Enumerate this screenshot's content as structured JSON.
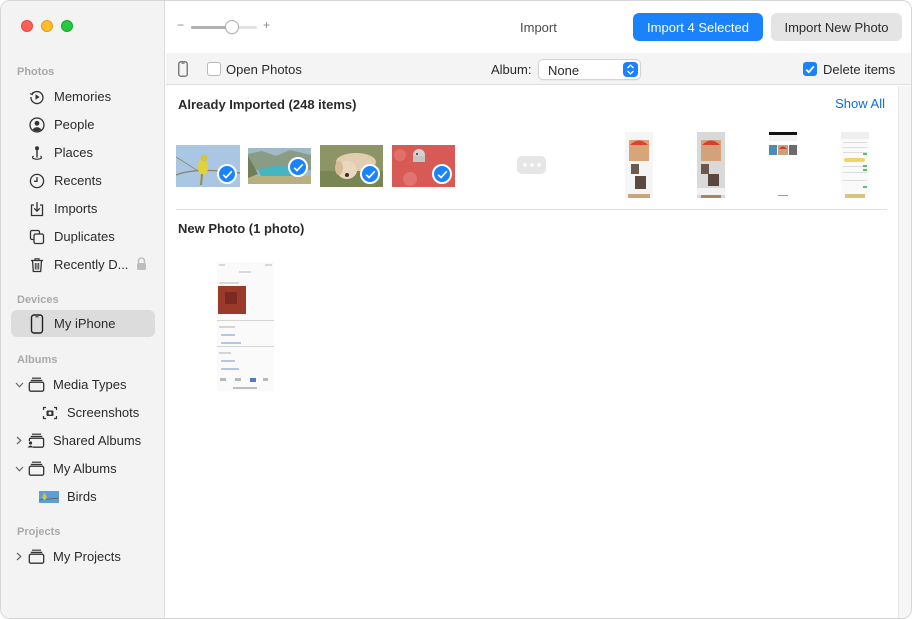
{
  "window": {
    "title": "Import"
  },
  "sidebar": {
    "sections": [
      {
        "label": "Photos",
        "items": [
          {
            "label": "Memories",
            "icon": "memories-icon"
          },
          {
            "label": "People",
            "icon": "people-icon"
          },
          {
            "label": "Places",
            "icon": "places-icon"
          },
          {
            "label": "Recents",
            "icon": "recents-icon"
          },
          {
            "label": "Imports",
            "icon": "imports-icon"
          },
          {
            "label": "Duplicates",
            "icon": "duplicates-icon"
          },
          {
            "label": "Recently D...",
            "icon": "trash-icon",
            "locked": true
          }
        ]
      },
      {
        "label": "Devices",
        "items": [
          {
            "label": "My iPhone",
            "icon": "iphone-icon",
            "selected": true
          }
        ]
      },
      {
        "label": "Albums",
        "items": [
          {
            "label": "Media Types",
            "icon": "album-stack-icon",
            "disclosure": "expanded"
          },
          {
            "label": "Screenshots",
            "icon": "screenshot-icon"
          },
          {
            "label": "Shared Albums",
            "icon": "shared-albums-icon",
            "disclosure": "collapsed"
          },
          {
            "label": "My Albums",
            "icon": "album-stack-icon",
            "disclosure": "expanded"
          },
          {
            "label": "Birds",
            "icon": "birds-album-thumbnail"
          }
        ]
      },
      {
        "label": "Projects",
        "items": [
          {
            "label": "My Projects",
            "icon": "album-stack-icon",
            "disclosure": "collapsed"
          }
        ]
      }
    ]
  },
  "toolbar": {
    "zoom_minus": "−",
    "zoom_plus": "+",
    "zoom_level": 0.62,
    "title": "Import",
    "import_selected_label": "Import 4 Selected",
    "import_new_label": "Import New Photo"
  },
  "options": {
    "open_photos_label": "Open Photos",
    "open_photos_checked": false,
    "album_label": "Album:",
    "album_value": "None",
    "delete_items_label": "Delete items",
    "delete_items_checked": true
  },
  "colors": {
    "accent": "#1a82fb",
    "link": "#0a6fe0"
  },
  "already_imported": {
    "title": "Already Imported (248 items)",
    "show_all_label": "Show All",
    "items": [
      {
        "subject": "yellow bird on branch",
        "selected": true
      },
      {
        "subject": "mountain lake",
        "selected": true
      },
      {
        "subject": "golden retriever puppy",
        "selected": true
      },
      {
        "subject": "dog in red flowers",
        "selected": true
      },
      {
        "subject": "more",
        "type": "ellipsis"
      },
      {
        "subject": "phone screenshot with cat in red hat",
        "type": "screenshot"
      },
      {
        "subject": "phone screenshot with cat in red hat",
        "type": "screenshot"
      },
      {
        "subject": "phone screenshot with photo strip",
        "type": "screenshot"
      },
      {
        "subject": "phone settings screenshot",
        "type": "screenshot"
      }
    ]
  },
  "new_photo": {
    "title": "New Photo (1 photo)",
    "items": [
      {
        "subject": "phone screenshot of album",
        "type": "screenshot"
      }
    ]
  }
}
